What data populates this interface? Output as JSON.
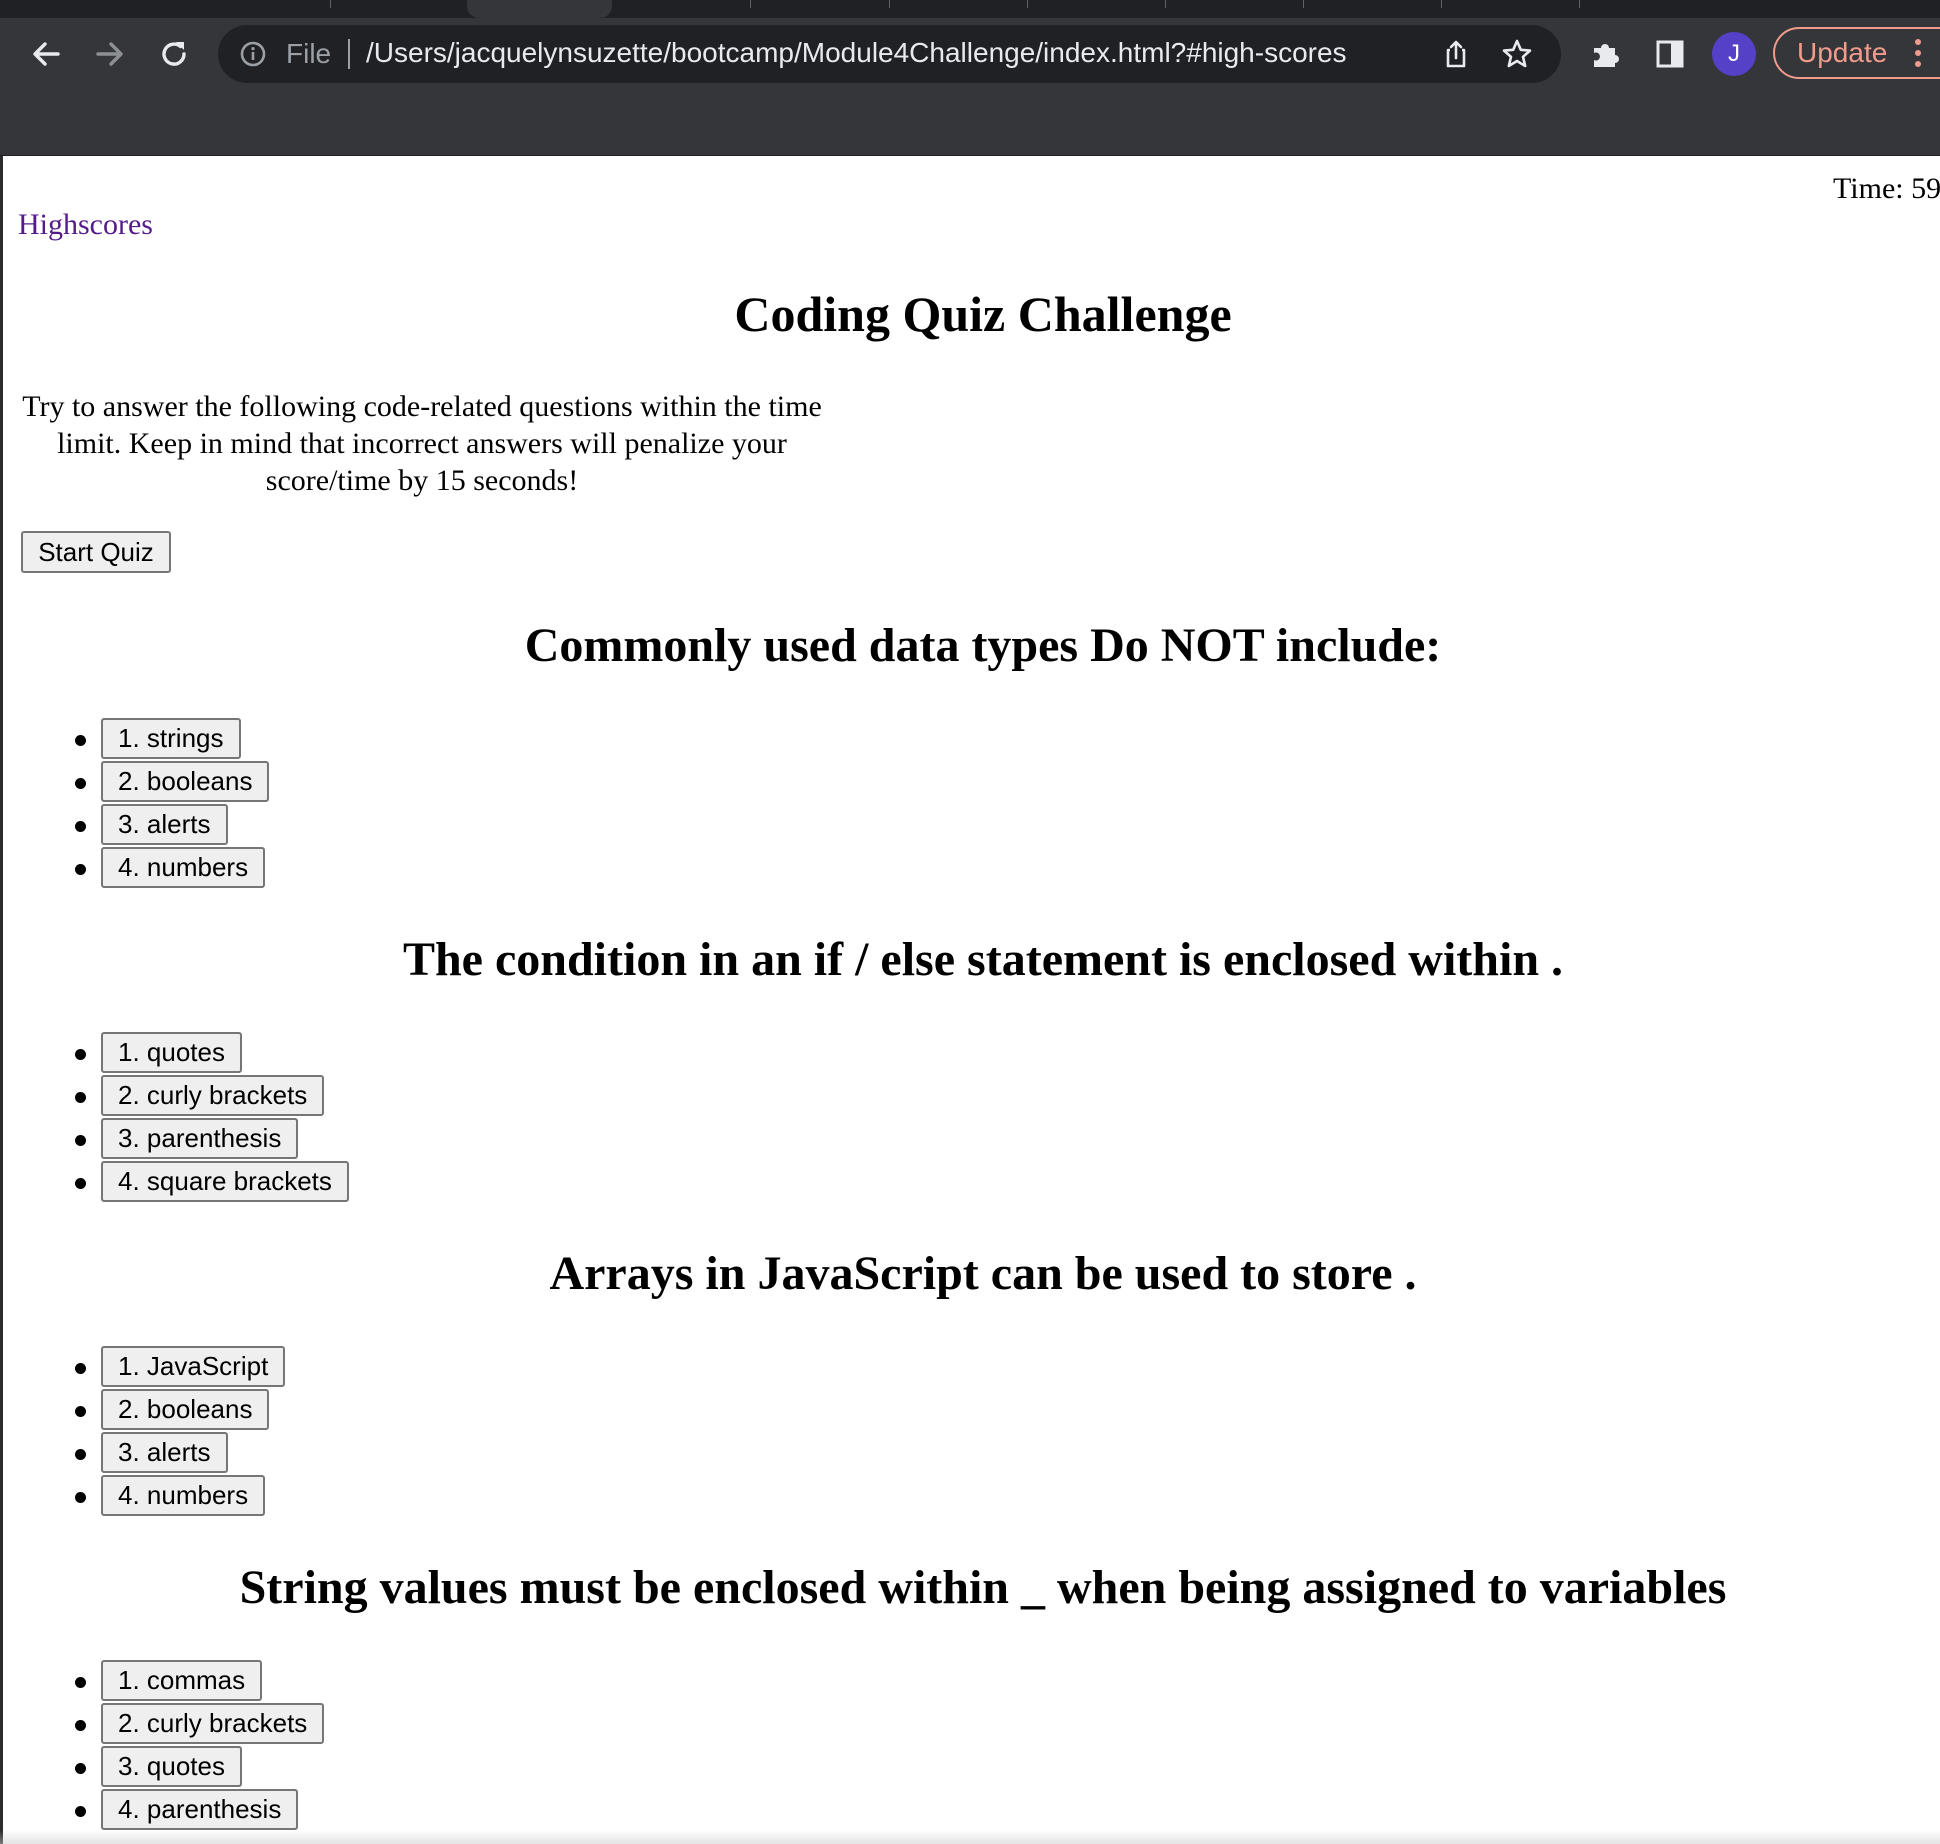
{
  "browser": {
    "file_label": "File",
    "url": "/Users/jacquelynsuzette/bootcamp/Module4Challenge/index.html?#high-scores",
    "profile_initial": "J",
    "update_label": "Update",
    "icons": [
      "back-arrow-icon",
      "forward-arrow-icon",
      "reload-icon",
      "info-icon",
      "share-icon",
      "star-icon",
      "puzzle-extensions-icon",
      "side-panel-icon",
      "kebab-menu-icon"
    ],
    "colors": {
      "chrome_bg": "#35363a",
      "omnibox_bg": "#202124",
      "avatar": "#5540c8",
      "update_accent": "#f29b8d"
    }
  },
  "page": {
    "timer": "Time: 59",
    "highscores_link": "Highscores",
    "title": "Coding Quiz Challenge",
    "intro": "Try to answer the following code-related questions within the time limit. Keep in mind that incorrect answers will penalize your score/time by 15 seconds!",
    "start_button": "Start Quiz",
    "link_color": "#551a8b"
  },
  "questions": [
    {
      "title": "Commonly used data types Do NOT include:",
      "answers": [
        "1. strings",
        "2. booleans",
        "3. alerts",
        "4. numbers"
      ]
    },
    {
      "title": "The condition in an if / else statement is enclosed within .",
      "answers": [
        "1. quotes",
        "2. curly brackets",
        "3. parenthesis",
        "4. square brackets"
      ]
    },
    {
      "title": "Arrays in JavaScript can be used to store .",
      "answers": [
        "1. JavaScript",
        "2. booleans",
        "3. alerts",
        "4. numbers"
      ]
    },
    {
      "title": "String values must be enclosed within _ when being assigned to variables",
      "answers": [
        "1. commas",
        "2. curly brackets",
        "3. quotes",
        "4. parenthesis"
      ]
    }
  ]
}
